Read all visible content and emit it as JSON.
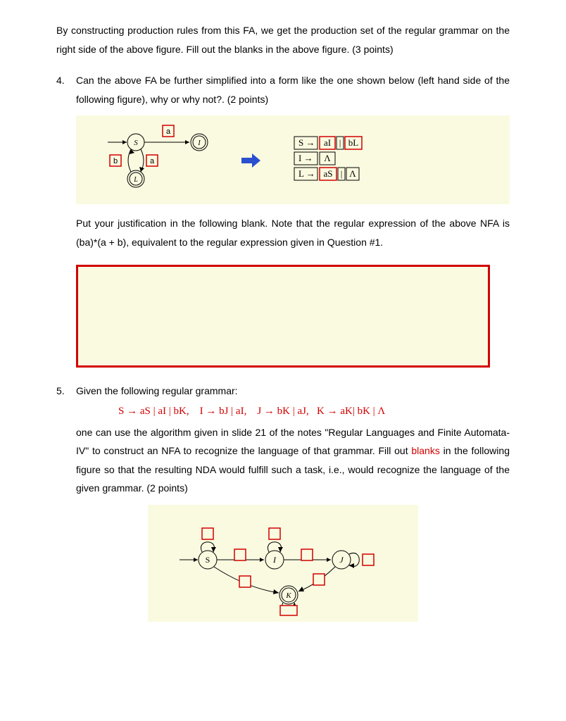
{
  "intro": {
    "text": "By constructing production rules from this FA, we get the production set of the regular grammar on the right side of the above figure. Fill out the blanks in the above figure. (3 points)"
  },
  "q4": {
    "num": "4.",
    "text": "Can the above FA be further simplified into a form like the one shown below (left hand side of the following figure), why or why not?.   (2 points)",
    "diagram": {
      "states": {
        "S": "S",
        "I": "I",
        "L": "L"
      },
      "labels": {
        "a_top": "a",
        "b": "b",
        "a_mid": "a"
      },
      "rules": {
        "r1_left": "S →",
        "r1_b1": "aI",
        "r1_sep": "|",
        "r1_b2": "bL",
        "r2_left": "I  →",
        "r2_b1": "Λ",
        "r3_left": "L  →",
        "r3_b1": "aS",
        "r3_sep": "|",
        "r3_b2": "Λ"
      }
    },
    "note": "Put your justification in the following blank. Note that the regular expression of the above NFA is (ba)*(a + b), equivalent to the regular expression given in Question #1."
  },
  "q5": {
    "num": "5.",
    "lead": "Given the following regular grammar:",
    "rules": "S → aS | aI | bK,    I → bJ | aI,    J → bK | aJ,   K → aK| bK | Λ",
    "body1": "one can use ",
    "body2": "the algorithm given in slide 21 of the notes \"Regular Languages and Finite Automata- IV\" to construct an NFA ",
    "body3": "to recognize the language of that grammar. Fill out ",
    "blanks_word": "blanks",
    "body4": " in the following figure so that the resulting NDA would fulfill such a task, i.e., would recognize the language of the given grammar.   (2 points)",
    "diagram": {
      "S": "S",
      "I": "I",
      "J": "J",
      "K": "K"
    }
  }
}
